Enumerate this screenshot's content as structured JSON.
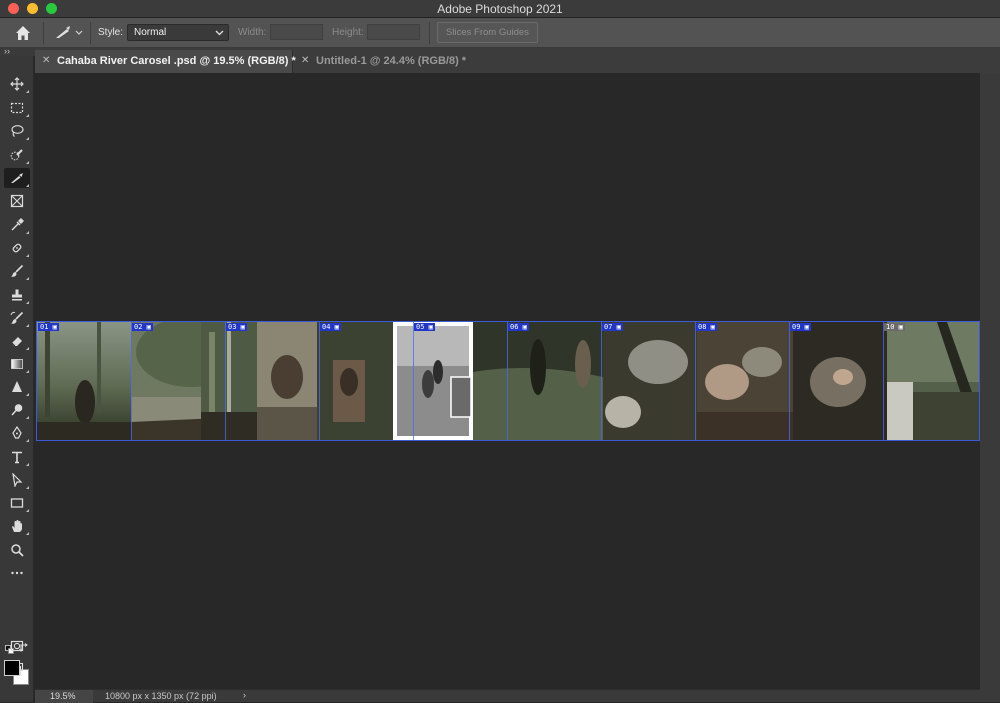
{
  "window": {
    "title": "Adobe Photoshop 2021"
  },
  "options_bar": {
    "style_label": "Style:",
    "style_value": "Normal",
    "width_label": "Width:",
    "height_label": "Height:",
    "slices_button": "Slices From Guides"
  },
  "tabs": [
    {
      "label": "Cahaba River Carosel .psd @ 19.5% (RGB/8) *",
      "active": true
    },
    {
      "label": "Untitled-1 @ 24.4% (RGB/8) *",
      "active": false
    }
  ],
  "toolbar": {
    "tools": [
      "move-tool",
      "marquee-tool",
      "lasso-tool",
      "quick-selection-tool",
      "slice-tool",
      "frame-tool",
      "eyedropper-tool",
      "healing-brush-tool",
      "brush-tool",
      "clone-stamp-tool",
      "history-brush-tool",
      "eraser-tool",
      "gradient-tool",
      "blur-tool",
      "dodge-tool",
      "pen-tool",
      "type-tool",
      "path-selection-tool",
      "rectangle-tool",
      "hand-tool",
      "zoom-tool",
      "more-tools"
    ],
    "active_tool": "slice-tool",
    "foreground_color": "#000000",
    "background_color": "#ffffff"
  },
  "slices": [
    {
      "label": "01"
    },
    {
      "label": "02"
    },
    {
      "label": "03"
    },
    {
      "label": "04"
    },
    {
      "label": "05"
    },
    {
      "label": "06"
    },
    {
      "label": "07"
    },
    {
      "label": "08"
    },
    {
      "label": "09"
    },
    {
      "label": "10"
    }
  ],
  "status_bar": {
    "zoom": "19.5%",
    "document_info": "10800 px x 1350 px (72 ppi)"
  }
}
